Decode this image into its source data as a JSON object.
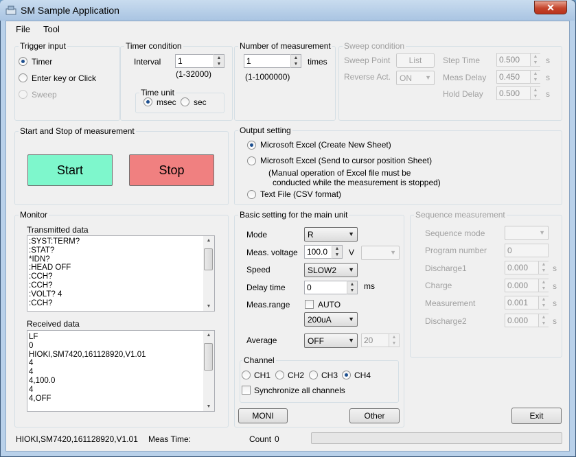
{
  "window": {
    "title": "SM Sample Application",
    "close_glyph": "✕"
  },
  "menu": {
    "file": "File",
    "tool": "Tool"
  },
  "trigger": {
    "title": "Trigger input",
    "timer": "Timer",
    "enter_key": "Enter key or Click",
    "sweep": "Sweep"
  },
  "timer_condition": {
    "title": "Timer condition",
    "interval_label": "Interval",
    "interval_value": "1",
    "interval_range": "(1-32000)",
    "time_unit_title": "Time unit",
    "msec": "msec",
    "sec": "sec"
  },
  "measurement_count": {
    "title": "Number of measurement",
    "value": "1",
    "unit": "times",
    "range": "(1-1000000)"
  },
  "sweep": {
    "title": "Sweep condition",
    "sweep_point_label": "Sweep Point",
    "list_button": "List",
    "reverse_label": "Reverse Act.",
    "reverse_value": "ON",
    "step_time_label": "Step Time",
    "step_time_value": "0.500",
    "meas_delay_label": "Meas Delay",
    "meas_delay_value": "0.450",
    "hold_delay_label": "Hold Delay",
    "hold_delay_value": "0.500",
    "unit_s": "s"
  },
  "start_stop": {
    "title": "Start and Stop of measurement",
    "start": "Start",
    "stop": "Stop"
  },
  "output": {
    "title": "Output setting",
    "option1": "Microsoft Excel (Create New Sheet)",
    "option2": "Microsoft Excel (Send to cursor position Sheet)",
    "note1": "(Manual operation of Excel file must be",
    "note2": "conducted while the measurement is stopped)",
    "option3": "Text File (CSV format)"
  },
  "monitor": {
    "title": "Monitor",
    "transmitted_label": "Transmitted data",
    "transmitted": [
      ":SYST:TERM?",
      ":STAT?",
      "*IDN?",
      ":HEAD OFF",
      ":CCH?",
      ":CCH?",
      ":VOLT? 4",
      ":CCH?"
    ],
    "received_label": "Received data",
    "received": [
      "LF",
      "0",
      "HIOKI,SM7420,161128920,V1.01",
      "4",
      "4",
      "4,100.0",
      "4",
      "4,OFF"
    ]
  },
  "basic": {
    "title": "Basic setting for the main unit",
    "mode_label": "Mode",
    "mode_value": "R",
    "voltage_label": "Meas. voltage",
    "voltage_value": "100.0",
    "voltage_unit": "V",
    "speed_label": "Speed",
    "speed_value": "SLOW2",
    "delay_label": "Delay time",
    "delay_value": "0",
    "delay_unit": "ms",
    "range_label": "Meas.range",
    "auto_label": "AUTO",
    "range_value": "200uA",
    "average_label": "Average",
    "average_value": "OFF",
    "average_count": "20",
    "channel_title": "Channel",
    "channels": [
      "CH1",
      "CH2",
      "CH3",
      "CH4"
    ],
    "sync_label": "Synchronize all channels"
  },
  "sequence": {
    "title": "Sequence measurement",
    "mode_label": "Sequence mode",
    "program_label": "Program number",
    "program_value": "0",
    "discharge1_label": "Discharge1",
    "discharge1_value": "0.000",
    "charge_label": "Charge",
    "charge_value": "0.000",
    "measurement_label": "Measurement",
    "measurement_value": "0.001",
    "discharge2_label": "Discharge2",
    "discharge2_value": "0.000",
    "unit_s": "s"
  },
  "buttons": {
    "moni": "MONI",
    "other": "Other",
    "exit": "Exit"
  },
  "status": {
    "device": "HIOKI,SM7420,161128920,V1.01",
    "meas_time_label": "Meas Time:",
    "count_label": "Count",
    "count_value": "0",
    "progress": 0
  },
  "colors": {
    "start_button": "#7ef7cc",
    "stop_button": "#f08080",
    "title_accent": "#b9d1ea"
  }
}
